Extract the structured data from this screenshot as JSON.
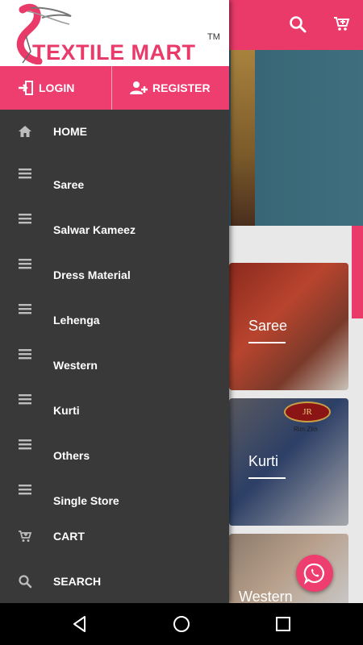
{
  "brand": {
    "name": "TEXTILE MART",
    "trademark": "TM",
    "accent_color": "#e93a6a"
  },
  "auth": {
    "login_label": "LOGIN",
    "register_label": "REGISTER"
  },
  "menu": [
    {
      "label": "HOME",
      "icon": "home-icon"
    },
    {
      "label": "Saree",
      "icon": "menu-lines-icon"
    },
    {
      "label": "Salwar Kameez",
      "icon": "menu-lines-icon"
    },
    {
      "label": "Dress Material",
      "icon": "menu-lines-icon"
    },
    {
      "label": "Lehenga",
      "icon": "menu-lines-icon"
    },
    {
      "label": "Western",
      "icon": "menu-lines-icon"
    },
    {
      "label": "Kurti",
      "icon": "menu-lines-icon"
    },
    {
      "label": "Others",
      "icon": "menu-lines-icon"
    },
    {
      "label": "Single Store",
      "icon": "menu-lines-icon"
    },
    {
      "label": "CART",
      "icon": "cart-icon"
    },
    {
      "label": "SEARCH",
      "icon": "search-icon"
    }
  ],
  "background": {
    "categories": [
      {
        "label": "Saree"
      },
      {
        "label": "Kurti",
        "badge": "JR",
        "badge_sub": "Rim Zim"
      },
      {
        "label": "Western"
      }
    ]
  },
  "system_nav": {
    "back": "back-icon",
    "home": "home-circle-icon",
    "recents": "recents-icon"
  }
}
